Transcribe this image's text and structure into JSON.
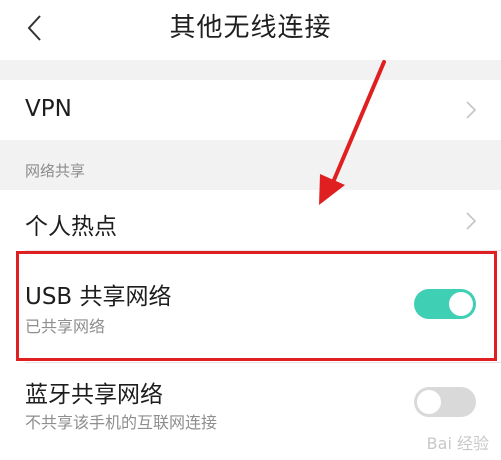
{
  "header": {
    "back_icon": "back-arrow-icon",
    "title": "其他无线连接"
  },
  "vpn": {
    "label": "VPN"
  },
  "network_sharing": {
    "section_title": "网络共享",
    "hotspot": {
      "label": "个人热点"
    },
    "usb_tethering": {
      "label": "USB 共享网络",
      "status": "已共享网络",
      "enabled": true
    },
    "bluetooth_tethering": {
      "label": "蓝牙共享网络",
      "status": "不共享该手机的互联网连接",
      "enabled": false
    }
  },
  "watermark": {
    "text": "Bai 经验"
  },
  "colors": {
    "toggle_on": "#3ecfb5",
    "toggle_off": "#d9d9d9",
    "annotation_red": "#e02020"
  }
}
